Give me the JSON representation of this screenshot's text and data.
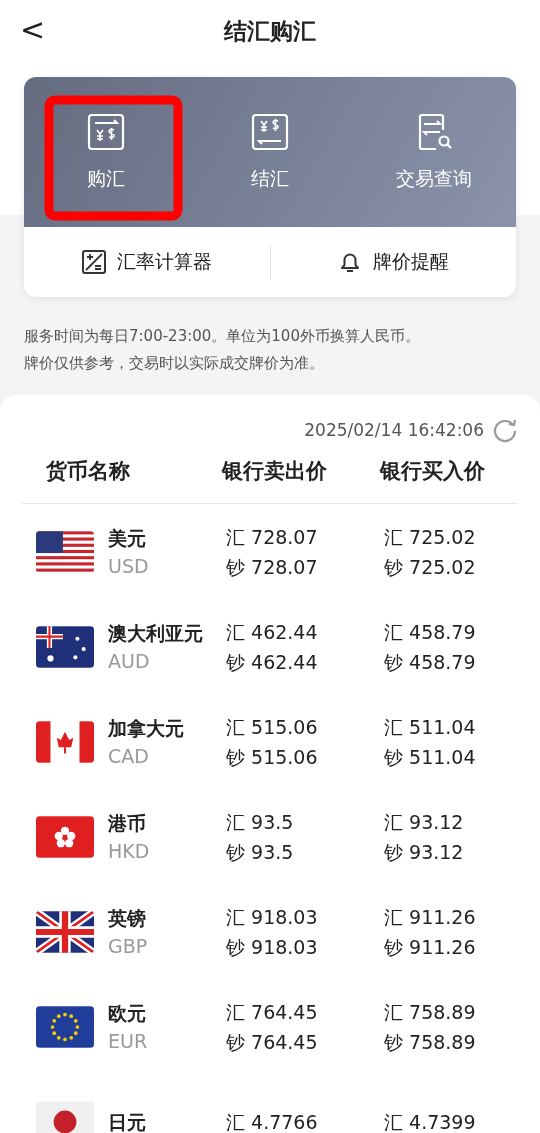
{
  "header": {
    "back": "<",
    "title": "结汇购汇"
  },
  "actions": [
    {
      "label": "购汇"
    },
    {
      "label": "结汇"
    },
    {
      "label": "交易查询"
    }
  ],
  "tools": [
    {
      "label": "汇率计算器"
    },
    {
      "label": "牌价提醒"
    }
  ],
  "notice": [
    "服务时间为每日7:00-23:00。单位为100外币换算人民币。",
    "牌价仅供参考，交易时以实际成交牌价为准。"
  ],
  "timestamp": "2025/02/14 16:42:06",
  "columns": [
    "货币名称",
    "银行卖出价",
    "银行买入价"
  ],
  "rows": [
    {
      "name": "美元",
      "code": "USD",
      "sell": [
        "汇 728.07",
        "钞 728.07"
      ],
      "buy": [
        "汇 725.02",
        "钞 725.02"
      ]
    },
    {
      "name": "澳大利亚元",
      "code": "AUD",
      "sell": [
        "汇 462.44",
        "钞 462.44"
      ],
      "buy": [
        "汇 458.79",
        "钞 458.79"
      ]
    },
    {
      "name": "加拿大元",
      "code": "CAD",
      "sell": [
        "汇 515.06",
        "钞 515.06"
      ],
      "buy": [
        "汇 511.04",
        "钞 511.04"
      ]
    },
    {
      "name": "港币",
      "code": "HKD",
      "sell": [
        "汇 93.5",
        "钞 93.5"
      ],
      "buy": [
        "汇 93.12",
        "钞 93.12"
      ]
    },
    {
      "name": "英镑",
      "code": "GBP",
      "sell": [
        "汇 918.03",
        "钞 918.03"
      ],
      "buy": [
        "汇 911.26",
        "钞 911.26"
      ]
    },
    {
      "name": "欧元",
      "code": "EUR",
      "sell": [
        "汇 764.45",
        "钞 764.45"
      ],
      "buy": [
        "汇 758.89",
        "钞 758.89"
      ]
    },
    {
      "name": "日元",
      "sell": [
        "汇 4.7766"
      ],
      "buy": [
        "汇 4.7399"
      ]
    }
  ]
}
